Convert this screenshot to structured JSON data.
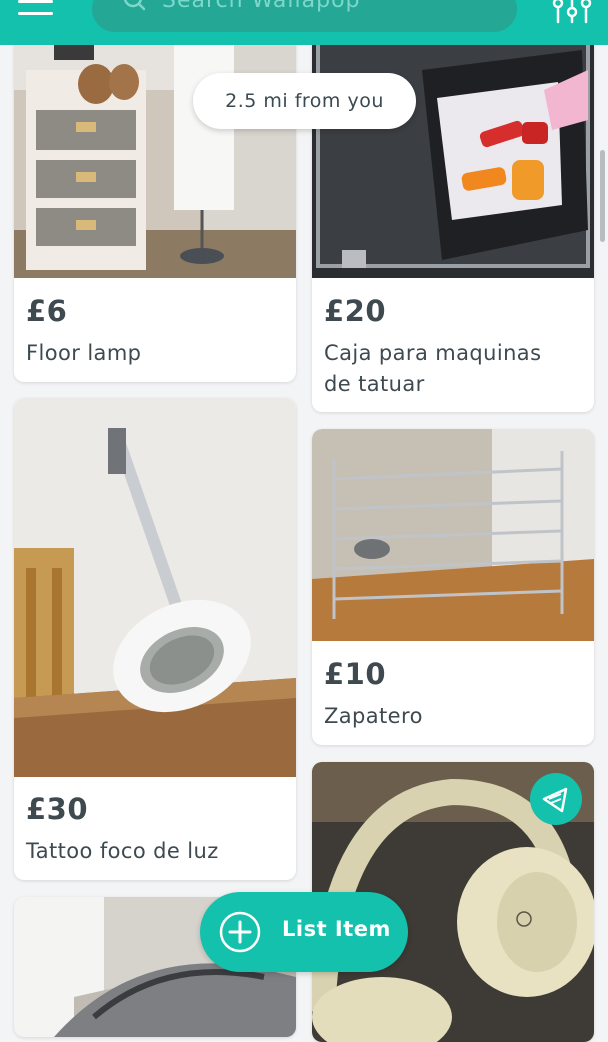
{
  "header": {
    "search_placeholder": "Search Wallapop"
  },
  "distance_label": "2.5 mi from you",
  "items": [
    {
      "price": "£6",
      "title": "Floor lamp"
    },
    {
      "price": "£20",
      "title": "Caja para maquinas de tatuar"
    },
    {
      "price": "£30",
      "title": "Tattoo foco de luz"
    },
    {
      "price": "£10",
      "title": "Zapatero"
    }
  ],
  "list_item_button": "List Item",
  "colors": {
    "brand": "#13c1ac",
    "search_bg": "#25a796",
    "text": "#3e4a50"
  }
}
